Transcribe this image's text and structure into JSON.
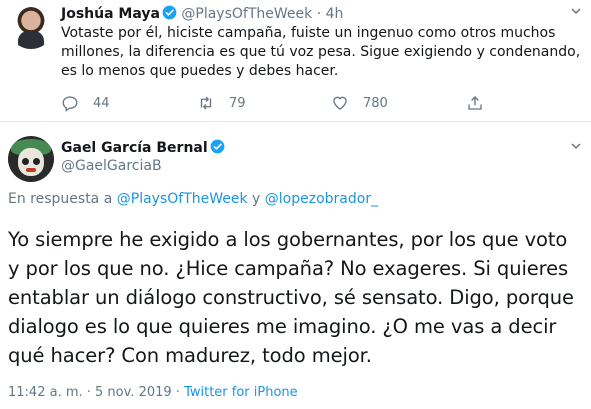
{
  "tweet1": {
    "name": "Joshúa Maya",
    "handle": "@PlaysOfTheWeek",
    "separator": "·",
    "time": "4h",
    "text": "Votaste por él, hiciste campaña, fuiste un ingenuo como otros muchos millones, la diferencia es que tú voz pesa. Sigue exigiendo y condenando, es lo menos que puedes y debes hacer.",
    "replies": "44",
    "retweets": "79",
    "likes": "780"
  },
  "tweet2": {
    "name": "Gael García Bernal",
    "handle": "@GaelGarciaB",
    "reply_prefix": "En respuesta a",
    "reply_to_1": "@PlaysOfTheWeek",
    "reply_joiner": "y",
    "reply_to_2": "@lopezobrador_",
    "text": "Yo siempre he exigido a los gobernantes, por los que voto y por los que no. ¿Hice campaña? No exageres. Si quieres entablar un diálogo constructivo, sé sensato. Digo, porque dialogo es lo que quieres me imagino. ¿O me vas a decir qué hacer? Con madurez, todo mejor.",
    "timestamp": "11:42 a. m. · 5 nov. 2019",
    "meta_separator": "·",
    "source": "Twitter for iPhone"
  },
  "icons": {
    "verified": "verified-badge-icon",
    "caret": "chevron-down-icon",
    "reply": "reply-icon",
    "retweet": "retweet-icon",
    "like": "heart-icon",
    "share": "share-icon"
  },
  "colors": {
    "link": "#1b95e0",
    "muted": "#657786",
    "verified": "#1da1f2",
    "text": "#14171a"
  }
}
